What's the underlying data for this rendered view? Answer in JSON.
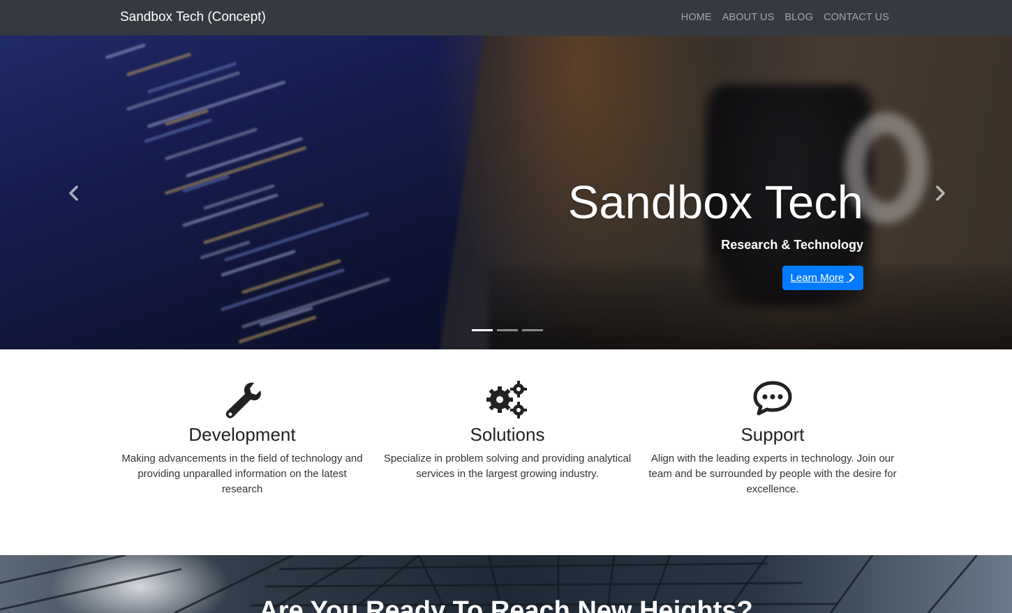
{
  "navbar": {
    "brand": "Sandbox Tech (Concept)",
    "links": [
      "HOME",
      "ABOUT US",
      "BLOG",
      "CONTACT US"
    ]
  },
  "hero": {
    "title": "Sandbox Tech",
    "subtitle": "Research & Technology",
    "button_label": "Learn More",
    "prev_icon": "chevron-left-icon",
    "next_icon": "chevron-right-icon",
    "slide_count": 3,
    "active_slide": 1
  },
  "features": [
    {
      "icon": "wrench-icon",
      "title": "Development",
      "description": "Making advancements in the field of technology and providing unparalled information on the latest research"
    },
    {
      "icon": "gears-icon",
      "title": "Solutions",
      "description": "Specialize in problem solving and providing analytical services in the largest growing industry."
    },
    {
      "icon": "comment-dots-icon",
      "title": "Support",
      "description": "Align with the leading experts in technology. Join our team and be surrounded by people with the desire for excellence."
    }
  ],
  "cta": {
    "title": "Are You Ready To Reach New Heights?"
  },
  "colors": {
    "navbar_bg": "#343a40",
    "accent": "#007bff",
    "text": "#212529"
  }
}
